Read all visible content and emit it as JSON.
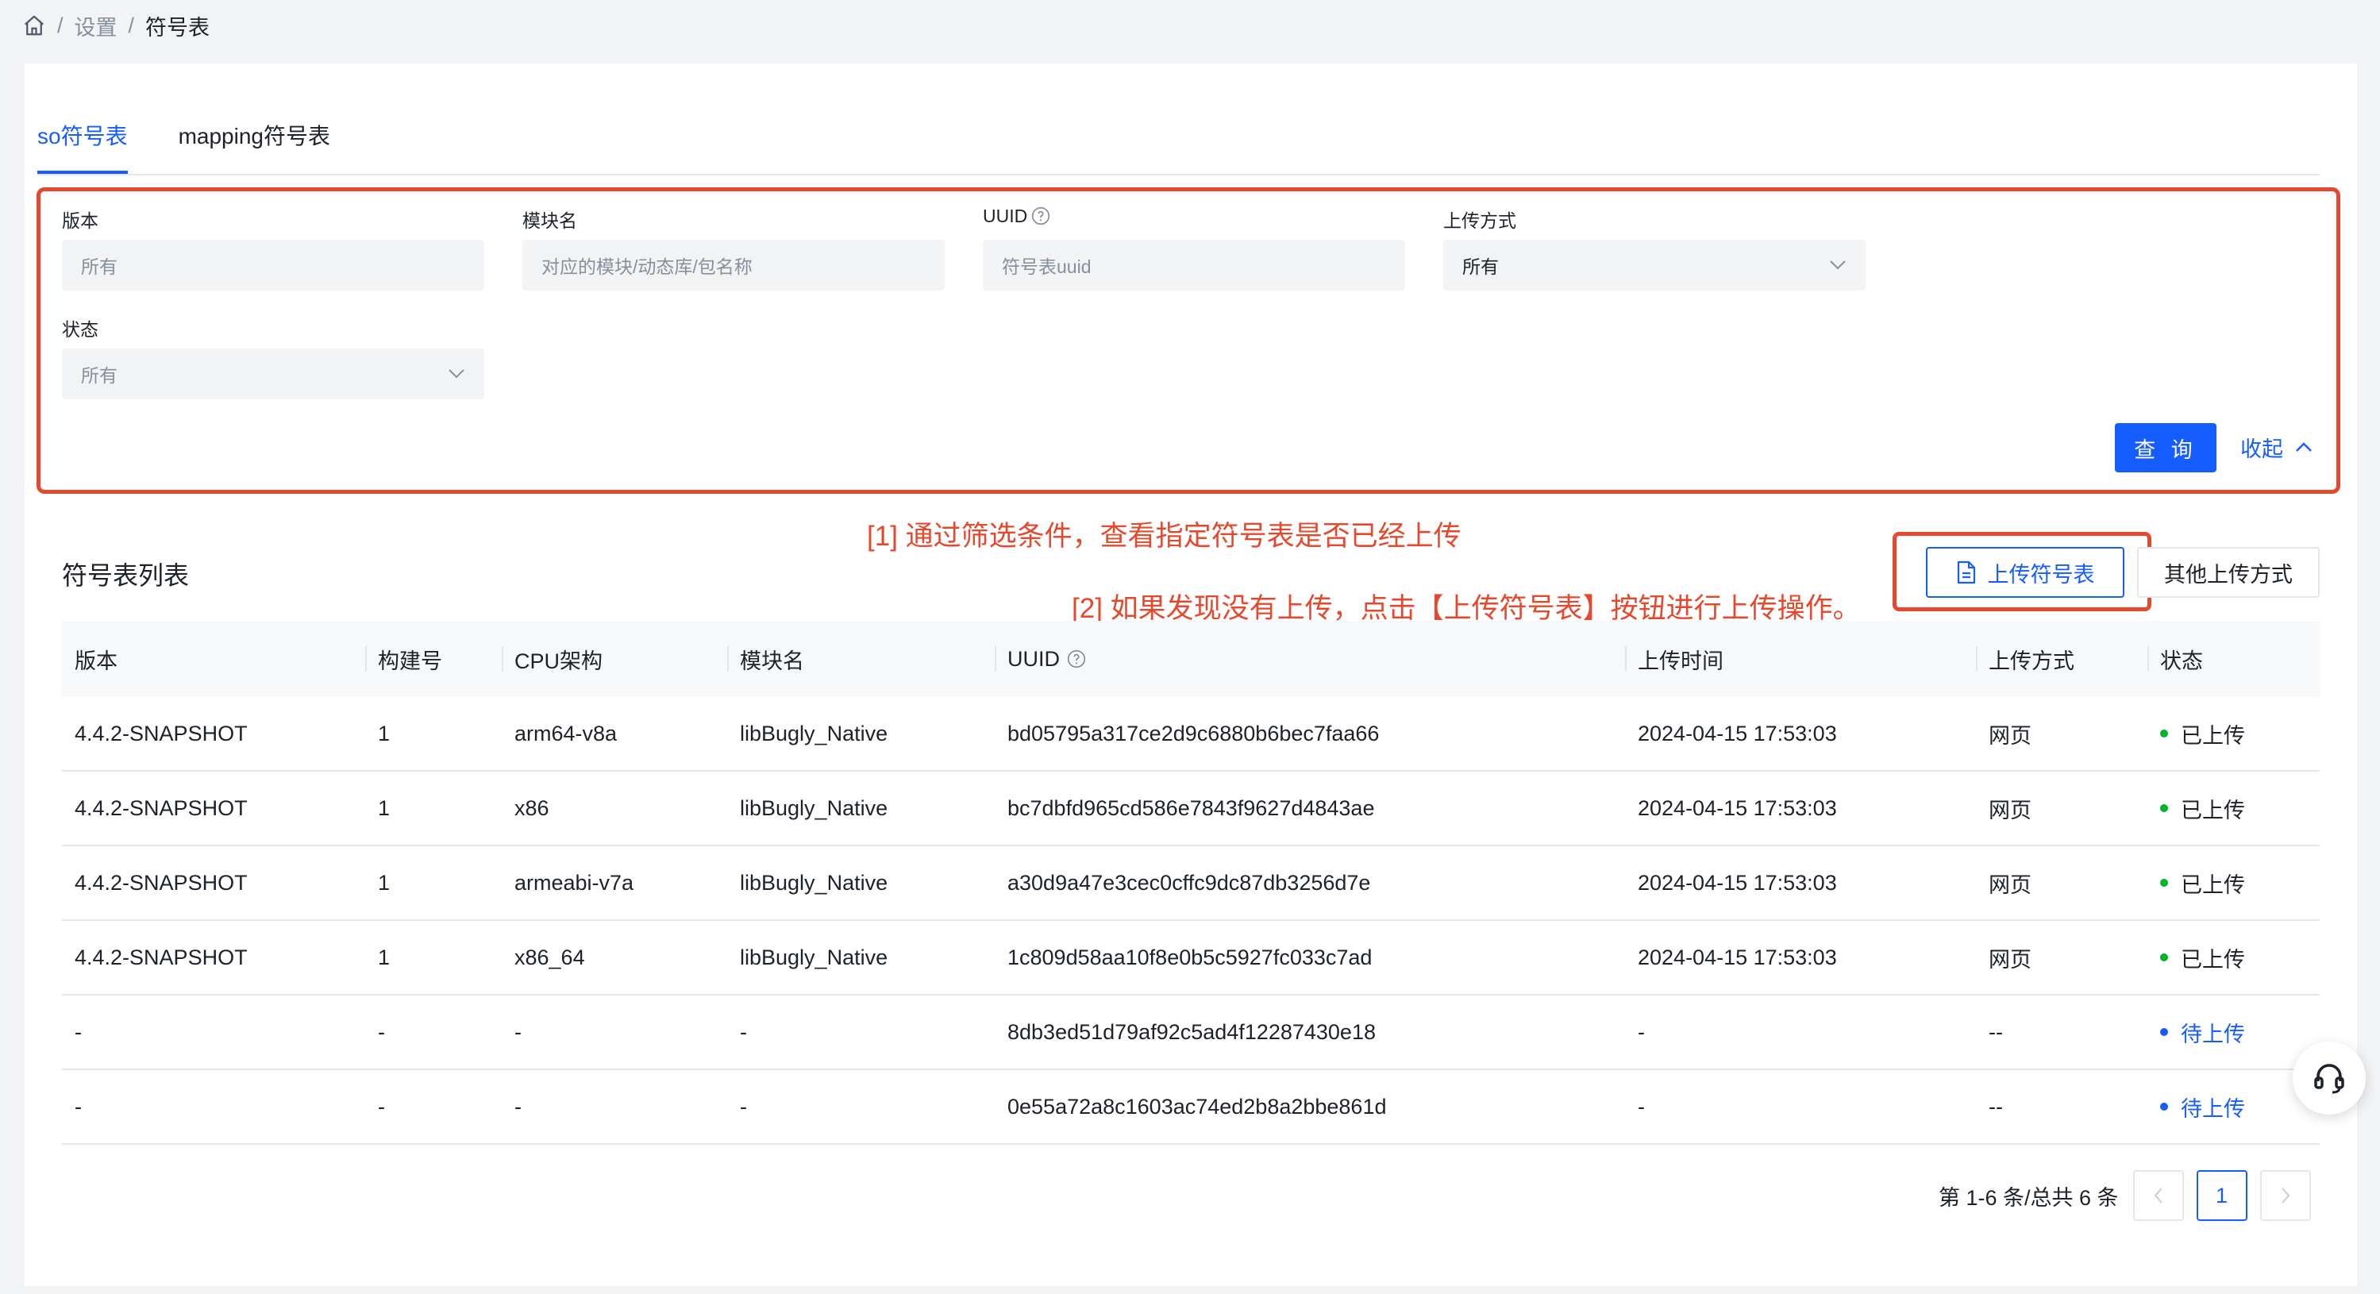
{
  "breadcrumb": {
    "home_icon": "home-icon",
    "items": [
      "设置",
      "符号表"
    ],
    "separator": "/"
  },
  "tabs": [
    {
      "label": "so符号表",
      "active": true
    },
    {
      "label": "mapping符号表",
      "active": false
    }
  ],
  "filters": {
    "version": {
      "label": "版本",
      "placeholder": "所有"
    },
    "module": {
      "label": "模块名",
      "placeholder": "对应的模块/动态库/包名称"
    },
    "uuid": {
      "label": "UUID",
      "placeholder": "符号表uuid"
    },
    "upload_method": {
      "label": "上传方式",
      "value": "所有"
    },
    "status": {
      "label": "状态",
      "value": "所有"
    },
    "query_button": "查 询",
    "collapse_label": "收起"
  },
  "annotations": {
    "note1": "[1] 通过筛选条件，查看指定符号表是否已经上传",
    "note2": "[2] 如果发现没有上传，点击【上传符号表】按钮进行上传操作。"
  },
  "list": {
    "title": "符号表列表",
    "upload_button": "上传符号表",
    "other_upload_button": "其他上传方式"
  },
  "table": {
    "headers": [
      "版本",
      "构建号",
      "CPU架构",
      "模块名",
      "UUID",
      "上传时间",
      "上传方式",
      "状态"
    ],
    "rows": [
      {
        "version": "4.4.2-SNAPSHOT",
        "build": "1",
        "cpu": "arm64-v8a",
        "module": "libBugly_Native",
        "uuid": "bd05795a317ce2d9c6880b6bec7faa66",
        "time": "2024-04-15 17:53:03",
        "method": "网页",
        "status": "已上传",
        "status_type": "uploaded"
      },
      {
        "version": "4.4.2-SNAPSHOT",
        "build": "1",
        "cpu": "x86",
        "module": "libBugly_Native",
        "uuid": "bc7dbfd965cd586e7843f9627d4843ae",
        "time": "2024-04-15 17:53:03",
        "method": "网页",
        "status": "已上传",
        "status_type": "uploaded"
      },
      {
        "version": "4.4.2-SNAPSHOT",
        "build": "1",
        "cpu": "armeabi-v7a",
        "module": "libBugly_Native",
        "uuid": "a30d9a47e3cec0cffc9dc87db3256d7e",
        "time": "2024-04-15 17:53:03",
        "method": "网页",
        "status": "已上传",
        "status_type": "uploaded"
      },
      {
        "version": "4.4.2-SNAPSHOT",
        "build": "1",
        "cpu": "x86_64",
        "module": "libBugly_Native",
        "uuid": "1c809d58aa10f8e0b5c5927fc033c7ad",
        "time": "2024-04-15 17:53:03",
        "method": "网页",
        "status": "已上传",
        "status_type": "uploaded"
      },
      {
        "version": "-",
        "build": "-",
        "cpu": "-",
        "module": "-",
        "uuid": "8db3ed51d79af92c5ad4f12287430e18",
        "time": "-",
        "method": "--",
        "status": "待上传",
        "status_type": "pending"
      },
      {
        "version": "-",
        "build": "-",
        "cpu": "-",
        "module": "-",
        "uuid": "0e55a72a8c1603ac74ed2b8a2bbe861d",
        "time": "-",
        "method": "--",
        "status": "待上传",
        "status_type": "pending"
      }
    ]
  },
  "pagination": {
    "info": "第 1-6 条/总共 6 条",
    "current_page": "1"
  },
  "colors": {
    "primary": "#165dff",
    "annotation_red": "#e5492d",
    "uploaded_dot": "#00b42a",
    "pending_dot": "#165dff"
  }
}
